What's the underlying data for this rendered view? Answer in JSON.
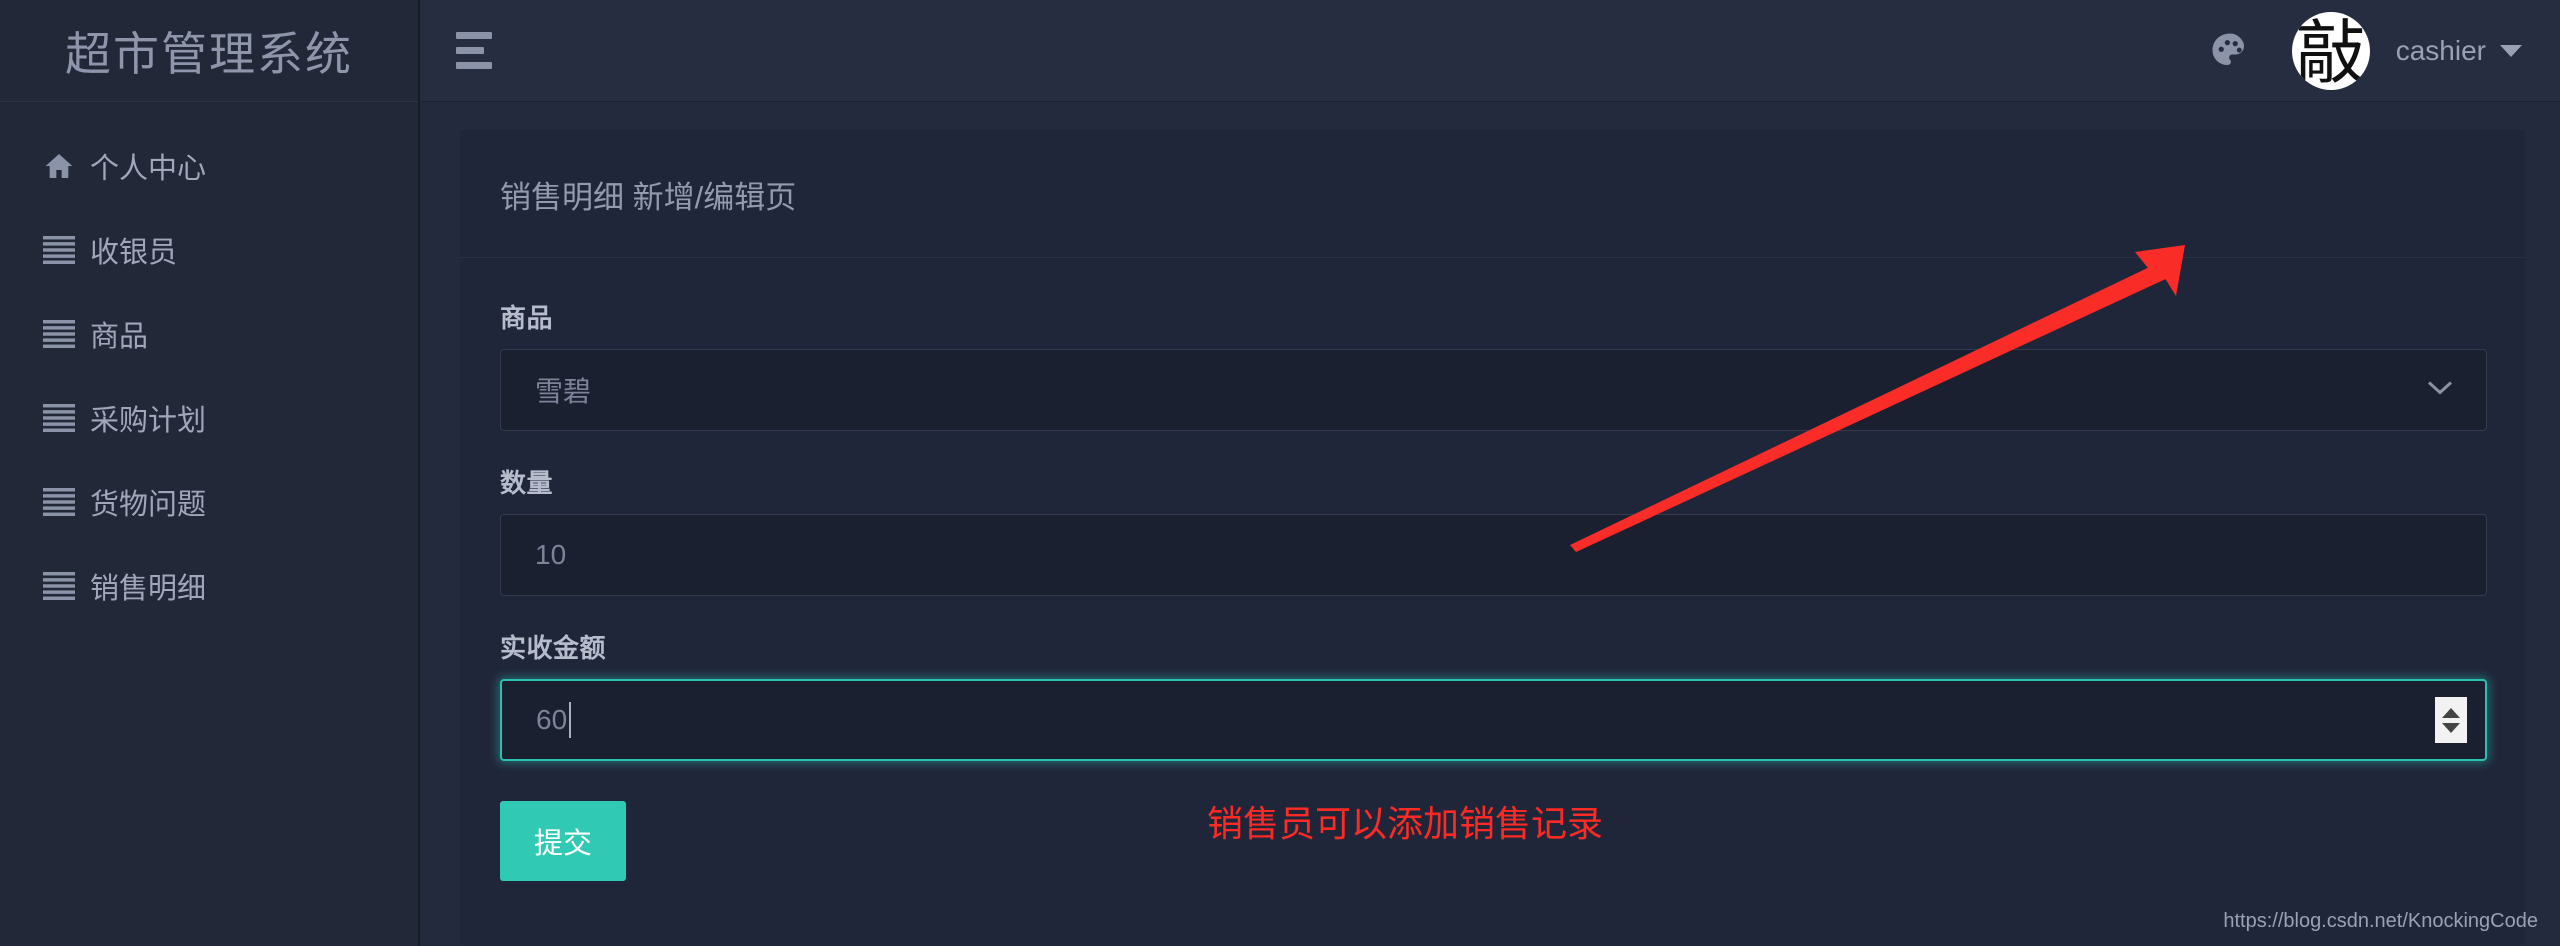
{
  "sidebar": {
    "brand_title": "超市管理系统",
    "items": [
      {
        "label": "个人中心",
        "icon": "home-icon"
      },
      {
        "label": "收银员",
        "icon": "list-icon"
      },
      {
        "label": "商品",
        "icon": "list-icon"
      },
      {
        "label": "采购计划",
        "icon": "list-icon"
      },
      {
        "label": "货物问题",
        "icon": "list-icon"
      },
      {
        "label": "销售明细",
        "icon": "list-icon"
      }
    ]
  },
  "topbar": {
    "menu_icon": "hamburger-icon",
    "theme_icon": "palette-icon",
    "avatar_char": "敲",
    "username": "cashier",
    "caret_icon": "chevron-down-icon"
  },
  "card": {
    "title": "销售明细 新增/编辑页",
    "fields": [
      {
        "label": "商品",
        "type": "select",
        "value": "雪碧",
        "icon": "chevron-down-icon"
      },
      {
        "label": "数量",
        "type": "text",
        "value": "10"
      },
      {
        "label": "实收金额",
        "type": "number",
        "value": "60",
        "focused": true,
        "icon": "spinner-icon"
      }
    ],
    "submit_label": "提交"
  },
  "annotations": {
    "note_text": "销售员可以添加销售记录",
    "note_color": "#ff2a23",
    "arrow_color": "#fa2c28",
    "arrow_icon": "arrow-up-right-icon"
  },
  "watermark": "https://blog.csdn.net/KnockingCode",
  "colors": {
    "accent": "#2fc9b4",
    "sidebar_bg": "#232838",
    "panel_bg": "#242a3e",
    "card_bg": "#20263a",
    "topbar_bg": "#272d41",
    "input_bg": "#1b2030",
    "text_muted": "#9aa1b5"
  }
}
